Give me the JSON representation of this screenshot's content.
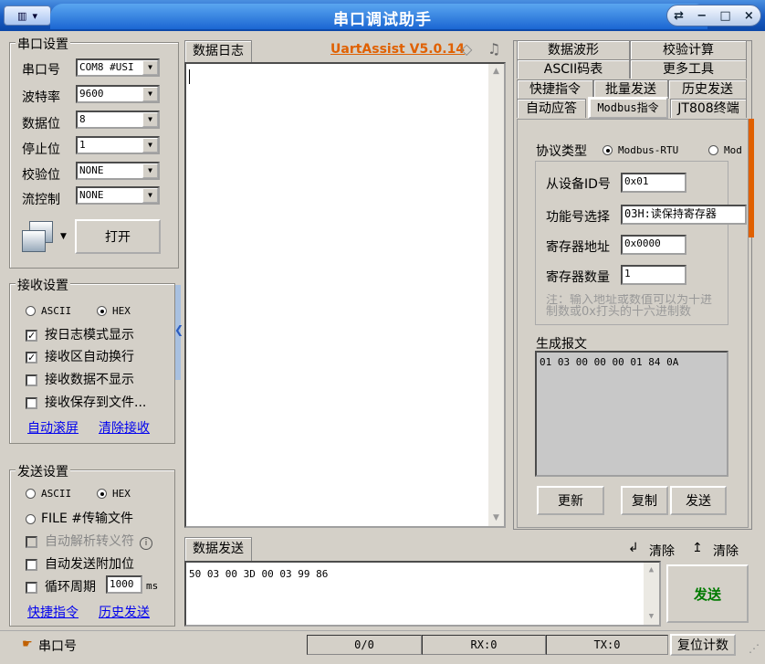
{
  "window": {
    "title": "串口调试助手",
    "menu_icon": "app-menu-icon",
    "controls": {
      "restore": "restore-icon",
      "minimize": "−",
      "maximize": "□",
      "close": "×"
    }
  },
  "serial": {
    "group_title": "串口设置",
    "port_label": "串口号",
    "port_value": "COM8 #USI",
    "baud_label": "波特率",
    "baud_value": "9600",
    "databits_label": "数据位",
    "databits_value": "8",
    "stopbits_label": "停止位",
    "stopbits_value": "1",
    "parity_label": "校验位",
    "parity_value": "NONE",
    "flow_label": "流控制",
    "flow_value": "NONE",
    "open_button": "打开"
  },
  "receive": {
    "group_title": "接收设置",
    "ascii": "ASCII",
    "hex": "HEX",
    "selected": "HEX",
    "log_mode": "按日志模式显示",
    "log_mode_checked": true,
    "auto_wrap": "接收区自动换行",
    "auto_wrap_checked": true,
    "no_display": "接收数据不显示",
    "no_display_checked": false,
    "save_file": "接收保存到文件...",
    "save_file_checked": false,
    "auto_scroll": "自动滚屏",
    "clear": "清除接收"
  },
  "send": {
    "group_title": "发送设置",
    "ascii": "ASCII",
    "hex": "HEX",
    "selected": "HEX",
    "file": "FILE #传输文件",
    "auto_parse": "自动解析转义符",
    "append_bit": "自动发送附加位",
    "loop": "循环周期",
    "loop_value": "1000",
    "loop_unit": "ms",
    "shortcut": "快捷指令",
    "history": "历史发送"
  },
  "log": {
    "tab": "数据日志",
    "brand": "UartAssist V5.0.14",
    "content": ""
  },
  "data_send": {
    "tab": "数据发送",
    "clear1": "清除",
    "clear2": "清除",
    "content": "50 03 00 3D 00 03 99 86",
    "send_button": "发送"
  },
  "right": {
    "tabs_row1": [
      "数据波形",
      "校验计算"
    ],
    "tabs_row2": [
      "ASCII码表",
      "更多工具"
    ],
    "tabs_row3": [
      "快捷指令",
      "批量发送",
      "历史发送"
    ],
    "tabs_row4": [
      "自动应答",
      "Modbus指令",
      "JT808终端"
    ],
    "protocol_label": "协议类型",
    "protocol_rtu": "Modbus-RTU",
    "protocol_other": "Mod",
    "slave_label": "从设备ID号",
    "slave_value": "0x01",
    "func_label": "功能号选择",
    "func_value": "03H:读保持寄存器",
    "reg_addr_label": "寄存器地址",
    "reg_addr_value": "0x0000",
    "reg_count_label": "寄存器数量",
    "reg_count_value": "1",
    "note": "注：输入地址或数值可以为十进制数或0x打头的十六进制数",
    "gen_label": "生成报文",
    "gen_value": "01 03 00 00 00 01 84 0A",
    "update": "更新",
    "copy": "复制",
    "send": "发送"
  },
  "status": {
    "port_label": "串口号",
    "count": "0/0",
    "rx": "RX:0",
    "tx": "TX:0",
    "reset": "复位计数"
  }
}
